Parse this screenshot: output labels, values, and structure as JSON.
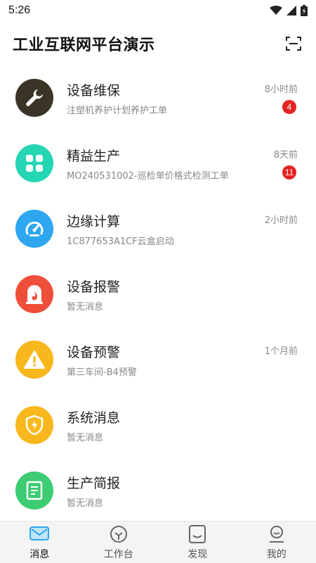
{
  "status_bar": {
    "time": "5:26"
  },
  "header": {
    "title": "工业互联网平台演示"
  },
  "messages": [
    {
      "title": "设备维保",
      "subtitle": "注塑机养护计划养护工单",
      "time": "8小时前",
      "badge": "4",
      "color": "#3a3427",
      "icon": "wrench-icon"
    },
    {
      "title": "精益生产",
      "subtitle": "MO240531002-巡检单价格式检测工单",
      "time": "8天前",
      "badge": "11",
      "color": "#25d6b5",
      "icon": "grid-icon"
    },
    {
      "title": "边缘计算",
      "subtitle": "1C877653A1CF云盒启动",
      "time": "2小时前",
      "badge": "",
      "color": "#2ea6f0",
      "icon": "gauge-icon"
    },
    {
      "title": "设备报警",
      "subtitle": "暂无消息",
      "time": "",
      "badge": "",
      "color": "#ef4e3a",
      "icon": "fire-alarm-icon"
    },
    {
      "title": "设备预警",
      "subtitle": "第三车间-B4预警",
      "time": "1个月前",
      "badge": "",
      "color": "#f8b71c",
      "icon": "warning-icon"
    },
    {
      "title": "系统消息",
      "subtitle": "暂无消息",
      "time": "",
      "badge": "",
      "color": "#f8b71c",
      "icon": "shield-bolt-icon"
    },
    {
      "title": "生产简报",
      "subtitle": "暂无消息",
      "time": "",
      "badge": "",
      "color": "#3dcc73",
      "icon": "document-icon"
    }
  ],
  "tabs": [
    {
      "label": "消息",
      "icon": "message-icon",
      "active": true
    },
    {
      "label": "工作台",
      "icon": "workbench-icon",
      "active": false
    },
    {
      "label": "发现",
      "icon": "discover-icon",
      "active": false
    },
    {
      "label": "我的",
      "icon": "profile-icon",
      "active": false
    }
  ],
  "colors": {
    "accent": "#2ea6f0",
    "badge": "#e52222"
  }
}
